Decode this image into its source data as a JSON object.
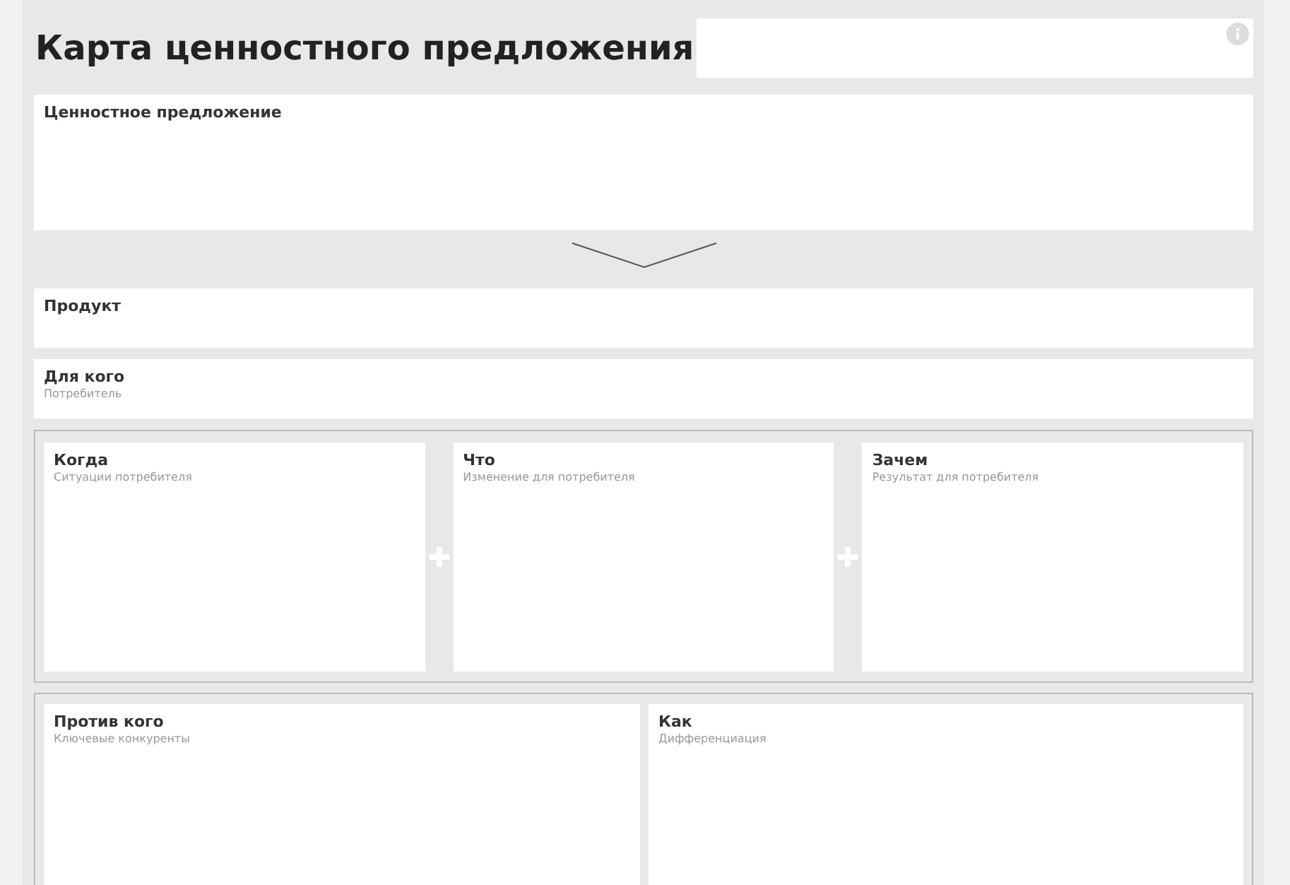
{
  "title": "Карта ценностного предложения",
  "value_proposition": {
    "label": "Ценностное предложение"
  },
  "product": {
    "label": "Продукт"
  },
  "audience": {
    "label": "Для кого",
    "hint": "Потребитель"
  },
  "formula": [
    {
      "label": "Когда",
      "hint": "Ситуации потребителя"
    },
    {
      "label": "Что",
      "hint": "Изменение для потребителя"
    },
    {
      "label": "Зачем",
      "hint": "Результат для потребителя"
    }
  ],
  "competition": [
    {
      "label": "Против кого",
      "hint": "Ключевые конкуренты"
    },
    {
      "label": "Как",
      "hint": "Дифференциация"
    }
  ]
}
